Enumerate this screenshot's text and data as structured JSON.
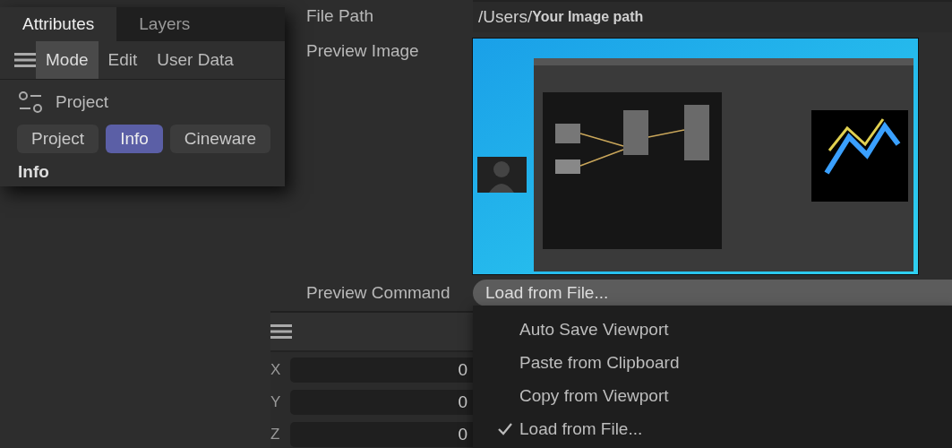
{
  "attributes_panel": {
    "tabs": [
      {
        "label": "Attributes",
        "selected": true
      },
      {
        "label": "Layers",
        "selected": false
      }
    ],
    "menu": [
      {
        "label": "Mode",
        "selected": true
      },
      {
        "label": "Edit",
        "selected": false
      },
      {
        "label": "User Data",
        "selected": false
      }
    ],
    "object_title": "Project",
    "sections": [
      {
        "label": "Project",
        "selected": false
      },
      {
        "label": "Info",
        "selected": true
      },
      {
        "label": "Cineware",
        "selected": false
      }
    ],
    "group_heading": "Info"
  },
  "properties": {
    "file_path_label": "File Path",
    "file_path": "/Users/**Your Image path**",
    "preview_image_label": "Preview Image",
    "preview_command_label": "Preview Command",
    "preview_command": "Load from File..."
  },
  "coordinates": [
    {
      "axis": "X",
      "value": "0"
    },
    {
      "axis": "Y",
      "value": "0"
    },
    {
      "axis": "Z",
      "value": "0"
    }
  ],
  "dropdown_menu": [
    {
      "label": "Auto Save Viewport",
      "checked": false
    },
    {
      "label": "Paste from Clipboard",
      "checked": false
    },
    {
      "label": "Copy from Viewport",
      "checked": false
    },
    {
      "label": "Load from File...",
      "checked": true
    }
  ]
}
